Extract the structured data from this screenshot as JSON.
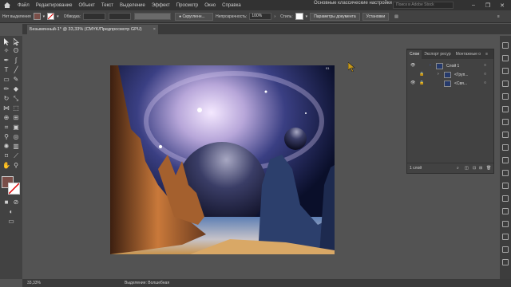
{
  "menubar": {
    "items": [
      "Файл",
      "Редактирование",
      "Объект",
      "Текст",
      "Выделение",
      "Эффект",
      "Просмотр",
      "Окно",
      "Справка"
    ],
    "workspace": "Основные классические настройки",
    "search_placeholder": "Поиск в Adobe Stock"
  },
  "controlbar": {
    "selection_label": "Нет выделения",
    "stroke_label": "Обводка:",
    "brush_label": "Скругленн...",
    "opacity_label": "Непрозрачность:",
    "opacity_value": "100%",
    "style_label": "Стиль:",
    "doc_setup_button": "Параметры документа",
    "preferences_button": "Установки",
    "fill_color": "#7a4e48"
  },
  "document": {
    "tab_title": "Безымянный-1* @ 33,33% (CMYK/Предпросмотр GPU)",
    "close_symbol": "×",
    "artboard_marker": "01"
  },
  "layers_panel": {
    "tabs": [
      "Слои",
      "Экспорт ресур",
      "Монтажные о"
    ],
    "rows": [
      {
        "name": "Слой 1"
      },
      {
        "name": "<Груп..."
      },
      {
        "name": "<Свя..."
      }
    ],
    "footer": "1 слой"
  },
  "status": {
    "zoom": "33,33%",
    "tool": "Выделение: Волшебная"
  }
}
